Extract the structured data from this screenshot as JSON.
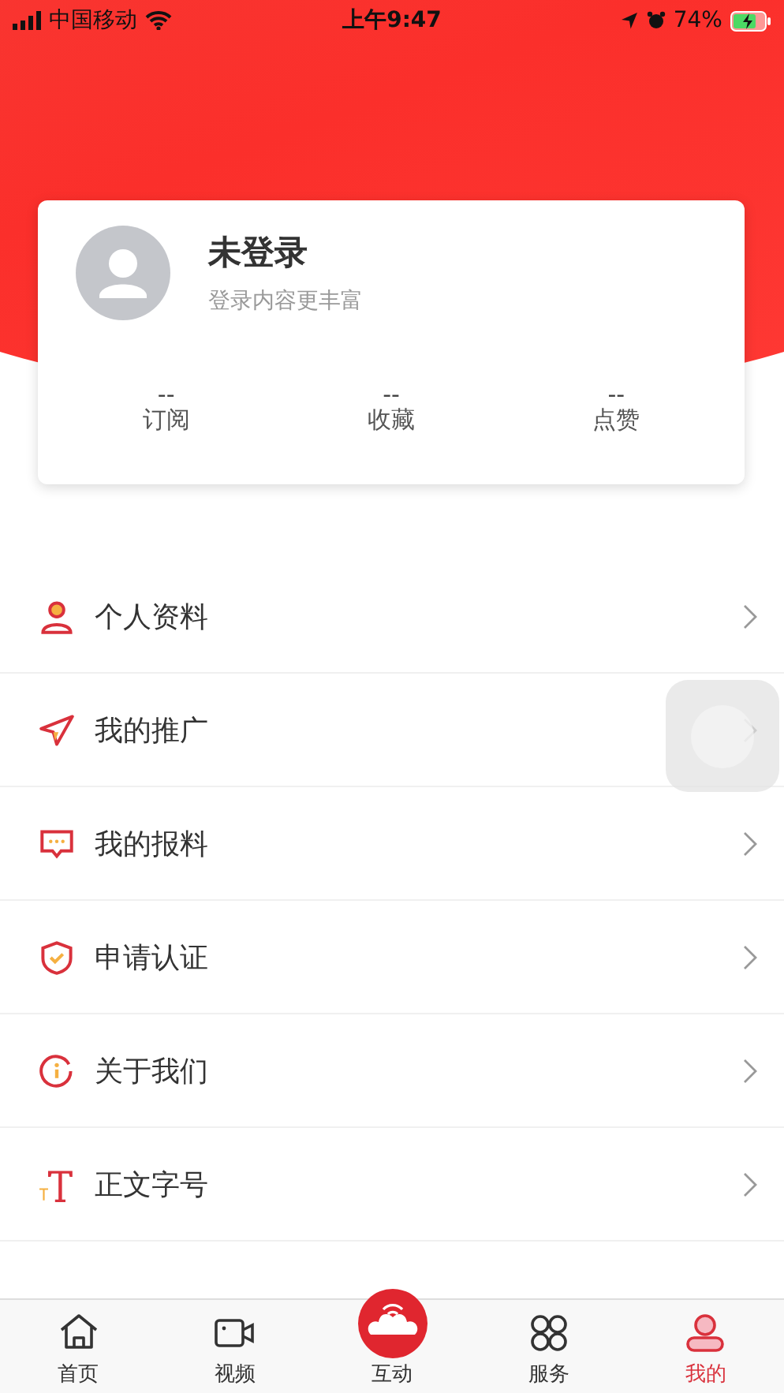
{
  "status_bar": {
    "carrier": "中国移动",
    "time": "上午9:47",
    "battery": "74%"
  },
  "profile": {
    "name": "未登录",
    "subtitle": "登录内容更丰富",
    "stats": [
      {
        "value": "--",
        "label": "订阅"
      },
      {
        "value": "--",
        "label": "收藏"
      },
      {
        "value": "--",
        "label": "点赞"
      }
    ]
  },
  "menu": [
    {
      "kind": "profile",
      "label": "个人资料"
    },
    {
      "kind": "promote",
      "label": "我的推广"
    },
    {
      "kind": "report",
      "label": "我的报料"
    },
    {
      "kind": "verify",
      "label": "申请认证"
    },
    {
      "kind": "about",
      "label": "关于我们"
    },
    {
      "kind": "font",
      "label": "正文字号"
    }
  ],
  "tabs": [
    {
      "kind": "home",
      "label": "首页",
      "selected": false
    },
    {
      "kind": "video",
      "label": "视频",
      "selected": false
    },
    {
      "kind": "interact",
      "label": "互动",
      "selected": false
    },
    {
      "kind": "service",
      "label": "服务",
      "selected": false
    },
    {
      "kind": "mine",
      "label": "我的",
      "selected": true
    }
  ]
}
